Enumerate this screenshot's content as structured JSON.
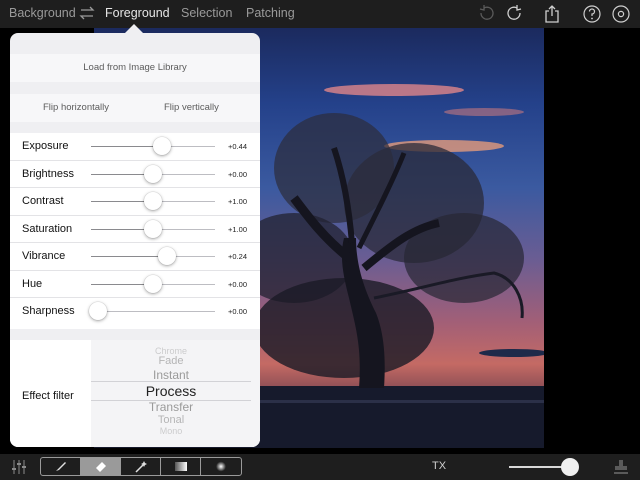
{
  "topbar": {
    "tabs": [
      "Background",
      "Foreground",
      "Selection",
      "Patching"
    ],
    "active_tab": "Foreground",
    "icons": [
      "swap-icon",
      "undo-icon",
      "redo-icon",
      "share-icon",
      "help-icon",
      "settings-icon"
    ]
  },
  "popover": {
    "load_label": "Load from Image Library",
    "flip_horizontal_label": "Flip horizontally",
    "flip_vertical_label": "Flip vertically",
    "sliders": [
      {
        "label": "Exposure",
        "value": "+0.44",
        "level": 0.57
      },
      {
        "label": "Brightness",
        "value": "+0.00",
        "level": 0.5
      },
      {
        "label": "Contrast",
        "value": "+1.00",
        "level": 0.5
      },
      {
        "label": "Saturation",
        "value": "+1.00",
        "level": 0.5
      },
      {
        "label": "Vibrance",
        "value": "+0.24",
        "level": 0.61
      },
      {
        "label": "Hue",
        "value": "+0.00",
        "level": 0.5
      },
      {
        "label": "Sharpness",
        "value": "+0.00",
        "level": 0.06
      }
    ],
    "effect_filter": {
      "label": "Effect filter",
      "options": [
        "Chrome",
        "Fade",
        "Instant",
        "Process",
        "Transfer",
        "Tonal",
        "Mono"
      ],
      "selected": "Process"
    }
  },
  "bottombar": {
    "tools": [
      "brush-icon",
      "eraser-icon",
      "magic-wand-icon",
      "gradient-icon",
      "soft-brush-icon"
    ],
    "active_tool": "eraser-icon",
    "mode_label": "TX",
    "slider_level": 0.95,
    "icons": [
      "adjust-icon",
      "stamp-icon"
    ]
  },
  "colors": {
    "bar_bg": "#1e1e1e",
    "popover_bg": "#efeff2",
    "tab_active": "#e6e6e6",
    "tab_inactive": "#9a9a9a"
  }
}
